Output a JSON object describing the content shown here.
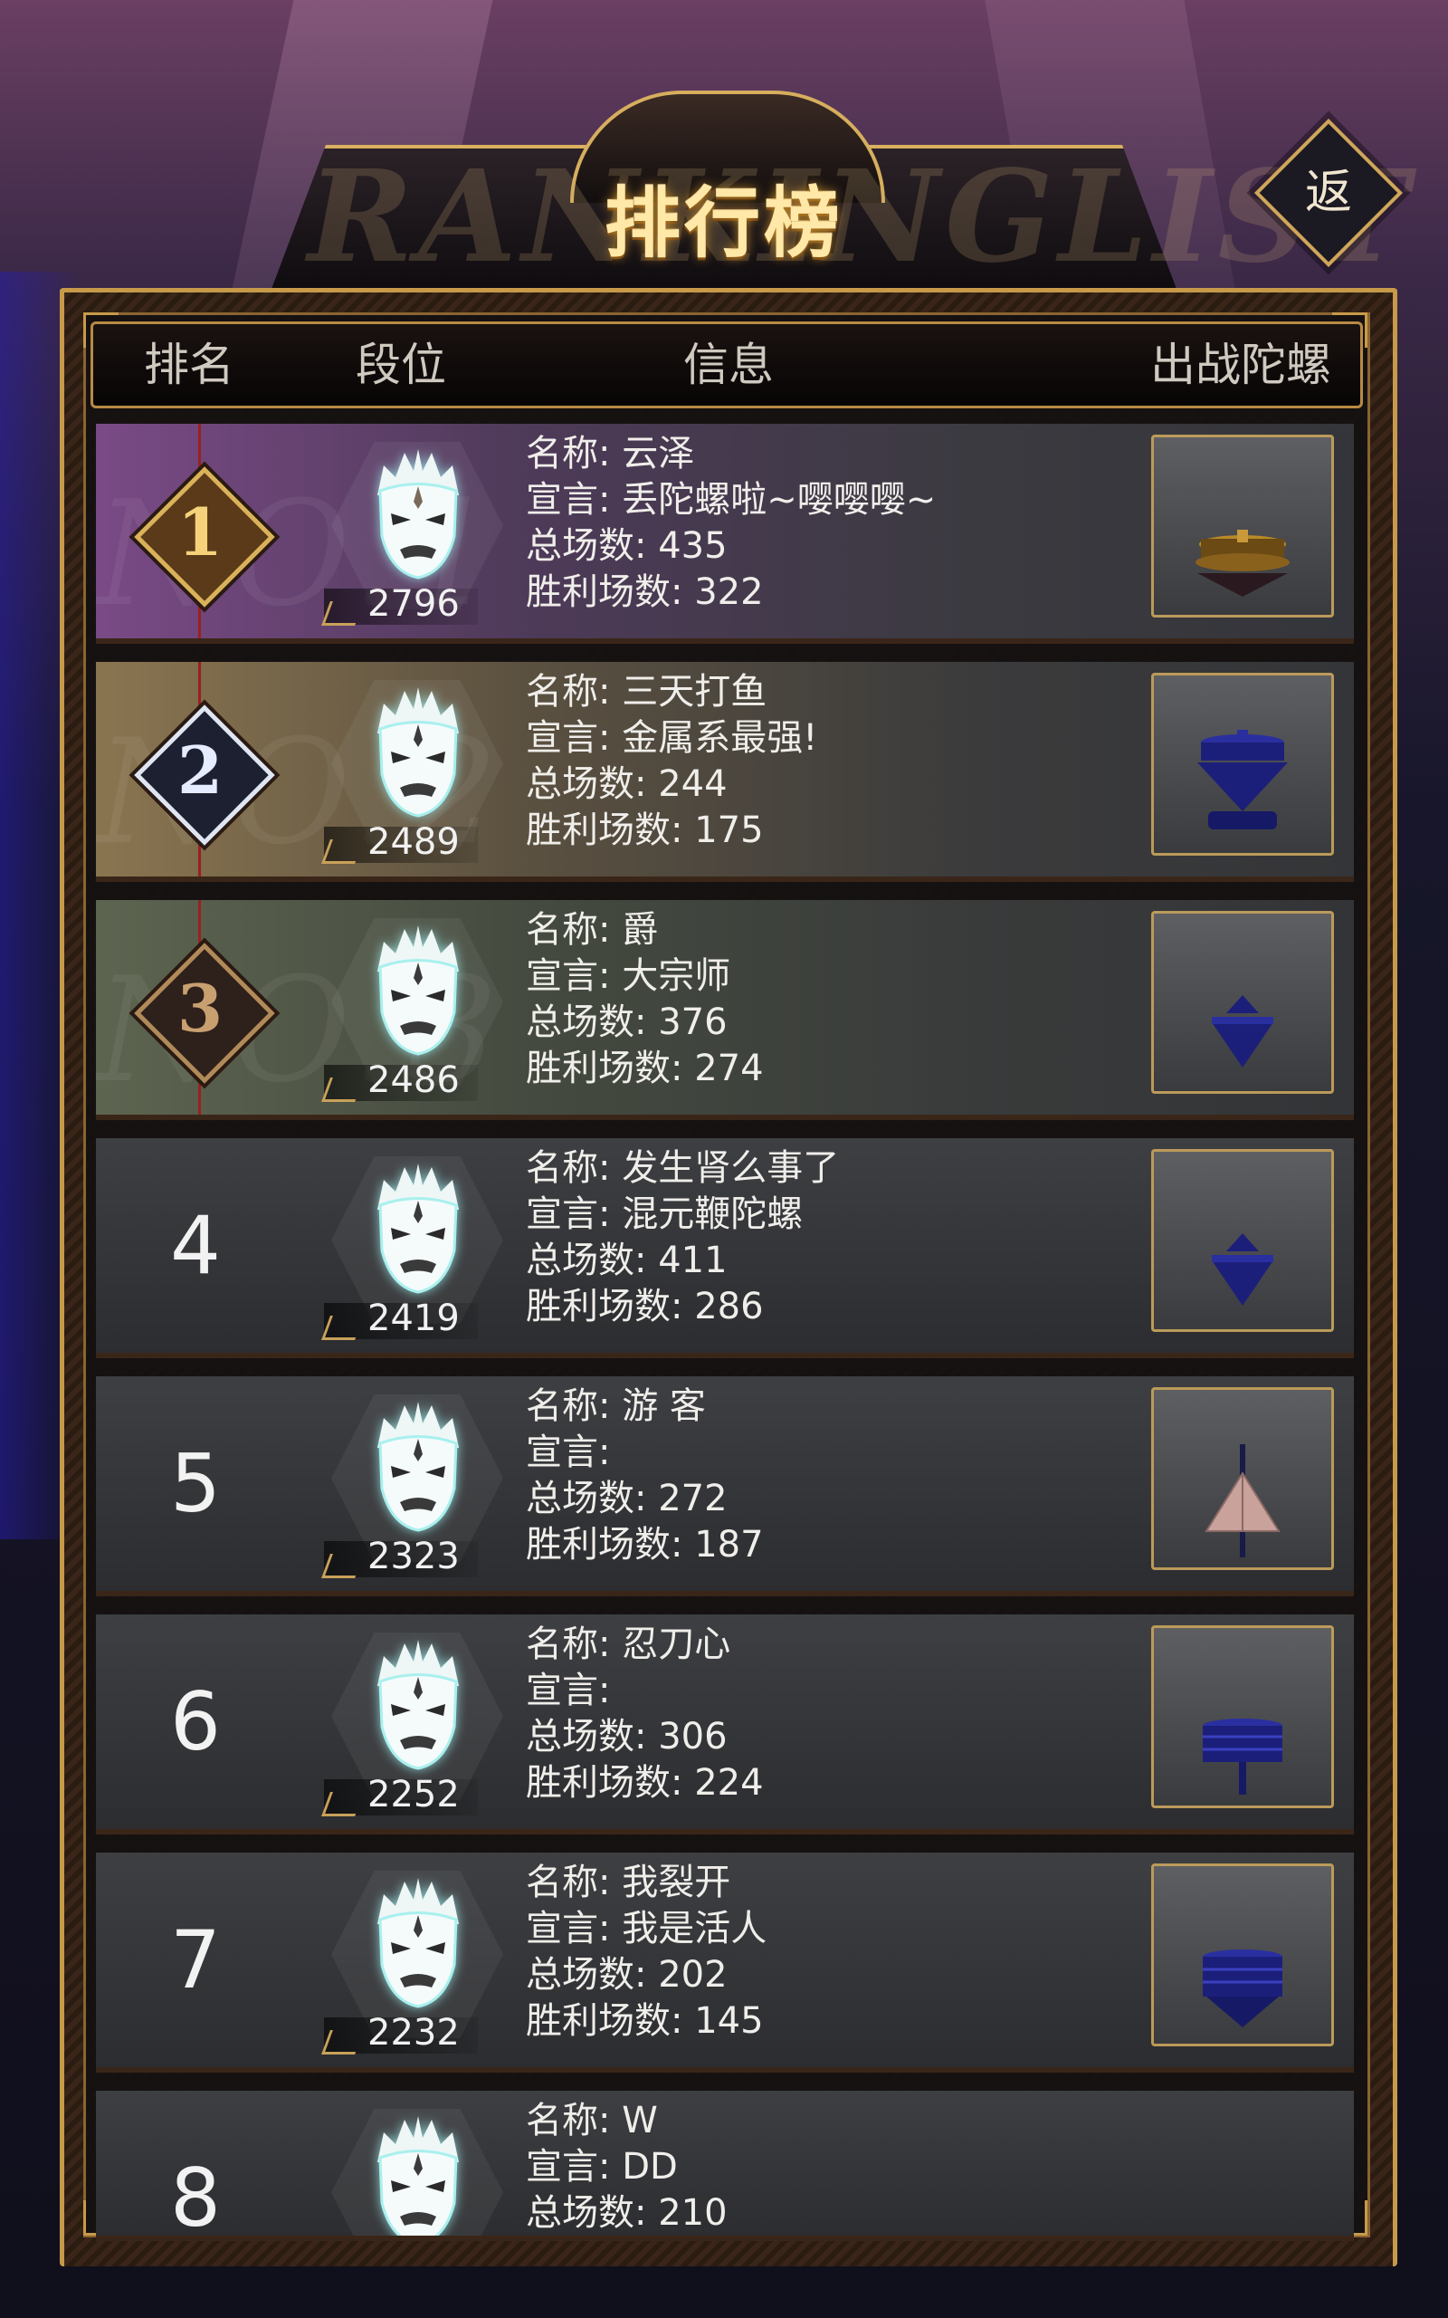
{
  "title": {
    "main": "排行榜",
    "background_text": "RANKINGLIST"
  },
  "back_button": {
    "label": "返"
  },
  "columns": {
    "rank": "排名",
    "tier": "段位",
    "info": "信息",
    "top": "出战陀螺"
  },
  "labels": {
    "name": "名称: ",
    "motto": "宣言: ",
    "total": "总场数: ",
    "wins": "胜利场数: "
  },
  "rows": [
    {
      "rank": "1",
      "score": "2796",
      "name": "云泽",
      "motto": "丢陀螺啦~嘤嘤嘤~",
      "total": "435",
      "wins": "322",
      "top_icon": "gold-flat-spinning-top"
    },
    {
      "rank": "2",
      "score": "2489",
      "name": "三天打鱼",
      "motto": "金属系最强!",
      "total": "244",
      "wins": "175",
      "top_icon": "blue-cone-spinning-top"
    },
    {
      "rank": "3",
      "score": "2486",
      "name": "爵",
      "motto": "大宗师",
      "total": "376",
      "wins": "274",
      "top_icon": "blue-small-cone-spinning-top"
    },
    {
      "rank": "4",
      "score": "2419",
      "name": "发生肾么事了",
      "motto": "混元鞭陀螺",
      "total": "411",
      "wins": "286",
      "top_icon": "blue-small-cone-spinning-top"
    },
    {
      "rank": "5",
      "score": "2323",
      "name": "游 客",
      "motto": "",
      "total": "272",
      "wins": "187",
      "top_icon": "pink-pyramid-spinning-top"
    },
    {
      "rank": "6",
      "score": "2252",
      "name": "忍刀心",
      "motto": "",
      "total": "306",
      "wins": "224",
      "top_icon": "blue-stacked-spinning-top"
    },
    {
      "rank": "7",
      "score": "2232",
      "name": "我裂开",
      "motto": "我是活人",
      "total": "202",
      "wins": "145",
      "top_icon": "blue-layered-spinning-top"
    },
    {
      "rank": "8",
      "score": "",
      "name": "W",
      "motto": "DD",
      "total": "210",
      "wins": "",
      "top_icon": ""
    }
  ],
  "colors": {
    "accent_gold": "#c79a4a",
    "gold_medal": "#d9b25a",
    "silver_medal": "#dfe6f2",
    "bronze_medal": "#b08a58",
    "top_blue": "#1c1f7a"
  }
}
